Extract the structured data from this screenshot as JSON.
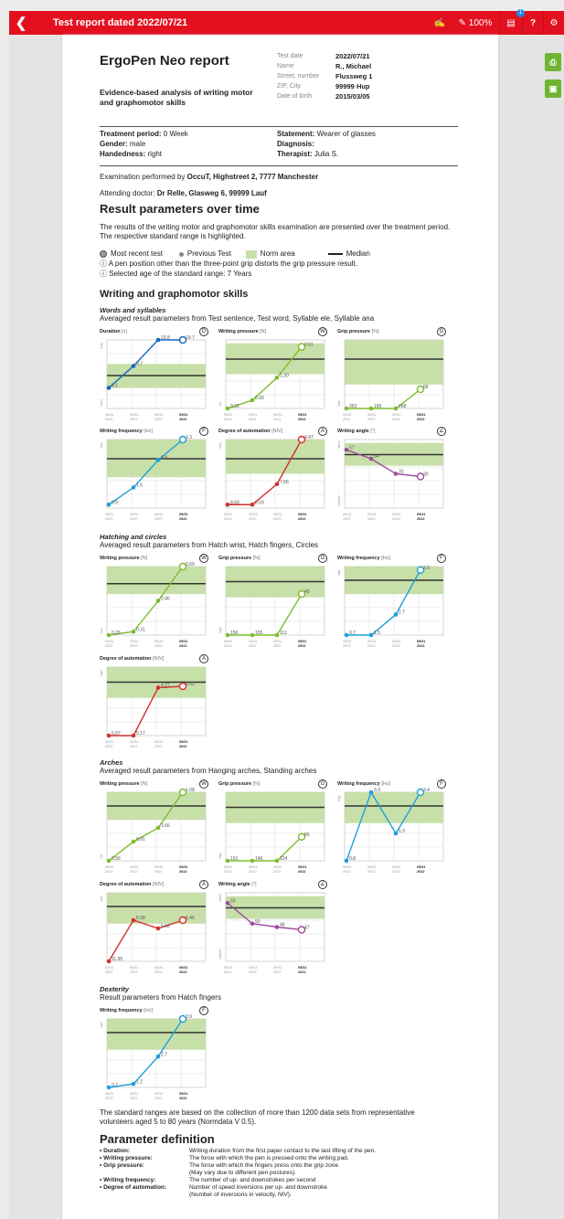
{
  "topbar": {
    "title": "Test report dated 2022/07/21",
    "zoom": "100%",
    "badge": "1",
    "help": "?"
  },
  "report": {
    "title": "ErgoPen Neo report",
    "subtitle": "Evidence-based analysis of writing motor and graphomotor skills",
    "meta": [
      {
        "k": "Test date",
        "v": "2022/07/21"
      },
      {
        "k": "Name",
        "v": "R., Michael"
      },
      {
        "k": "Street, number",
        "v": "Flussweg 1"
      },
      {
        "k": "ZIP, City",
        "v": "99999 Hup"
      },
      {
        "k": "Date of birth",
        "v": "2015/03/05"
      }
    ],
    "info_left": [
      {
        "k": "Treatment period:",
        "v": " 0 Week"
      },
      {
        "k": "Gender:",
        "v": " male"
      },
      {
        "k": "Handedness:",
        "v": " right"
      }
    ],
    "info_right": [
      {
        "k": "Statement:",
        "v": " Wearer of glasses"
      },
      {
        "k": "Diagnosis:",
        "v": ""
      },
      {
        "k": "Therapist:",
        "v": " Julia S."
      }
    ],
    "examination_prefix": "Examination performed by ",
    "examination_value": "OccuT, Highstreet 2, 7777 Manchester",
    "doctor_prefix": "Attending doctor: ",
    "doctor_value": "Dr Relle, Glasweg 6, 99999 Lauf",
    "result_heading": "Result parameters over time",
    "result_text": "The results of the writing motor and graphomotor skills examination are presented over the treatment period. The respective standard range is highlighted.",
    "legend": {
      "most_recent": "Most recent test",
      "previous": "Previous Test",
      "norm": "Norm area",
      "median": "Median"
    },
    "note1": "A pen position other than the three-point grip distorts the grip pressure result.",
    "note2": "Selected age of the standard range: 7 Years",
    "skills_heading": "Writing and graphomotor skills",
    "sections": [
      {
        "title": "Words and syllables",
        "desc": "Averaged result parameters from Test sentence, Test word, Syllable ele, Syllable ana"
      },
      {
        "title": "Hatching and circles",
        "desc": "Averaged result parameters from Hatch wrist, Hatch fingers, Circles"
      },
      {
        "title": "Arches",
        "desc": "Averaged result parameters from Hanging arches, Standing arches"
      },
      {
        "title": "Dexterity",
        "desc": "Result parameters from Hatch fingers"
      }
    ],
    "footer_text": "The standard ranges are based on the collection of more than 1200 data sets from representative volunteers aged 5 to 80 years (Normdata V 0.5).",
    "param_heading": "Parameter definition",
    "params": [
      {
        "k": "• Duration:",
        "v": "Writing duration from the first paper contact to the last lifting of the pen."
      },
      {
        "k": "• Writing pressure:",
        "v": "The force with which the pen is pressed onto the writing pad."
      },
      {
        "k": "• Grip pressure:",
        "v": "The force with which the fingers press onto the grip zone"
      },
      {
        "k": "",
        "v": "(May vary due to different pen postures)."
      },
      {
        "k": "• Writing frequency:",
        "v": "The number of up- and downstrokes per second"
      },
      {
        "k": "• Degree of automation:",
        "v": "Number of speed inversions per up- and downstroke"
      },
      {
        "k": "",
        "v": "(Number of inversions in velocity, NIV)."
      }
    ]
  },
  "chart_labels": {
    "x": [
      "05/31 2022",
      "05/31 2022",
      "05/31 2022",
      "05/31 2022"
    ],
    "high": "high",
    "low": "low",
    "steep": "steep",
    "shallow": "shallow"
  },
  "chart_data": [
    {
      "type": "line",
      "group": "Words and syllables",
      "title": "Duration",
      "unit": "[s]",
      "icon": "D",
      "labels": [
        "8.1",
        "9.7",
        "19.8",
        "19.7"
      ],
      "values": [
        0.3,
        0.62,
        1.0,
        1.0
      ],
      "norm": [
        0.3,
        0.65
      ],
      "median": 0.48,
      "color": "#1565c0",
      "ymax": "long",
      "ymin": "short"
    },
    {
      "type": "line",
      "group": "Words and syllables",
      "title": "Writing pressure",
      "unit": "[N]",
      "icon": "W",
      "labels": [
        "0.31",
        "0.09",
        "1.30",
        "0.91"
      ],
      "values": [
        0.0,
        0.12,
        0.45,
        0.9
      ],
      "norm": [
        0.5,
        0.95
      ],
      "median": 0.72,
      "color": "#7cbd2f",
      "ymin": "low"
    },
    {
      "type": "line",
      "group": "Words and syllables",
      "title": "Grip pressure",
      "unit": "[%]",
      "icon": "G",
      "labels": [
        "363",
        "165",
        "168",
        "68"
      ],
      "values": [
        0.0,
        0.0,
        0.0,
        0.28
      ],
      "norm": [
        0.35,
        1.0
      ],
      "median": 0.72,
      "color": "#7cbd2f",
      "ymin": "high"
    },
    {
      "type": "line",
      "group": "Words and syllables",
      "title": "Writing frequency",
      "unit": "[Hz]",
      "icon": "F",
      "labels": [
        "0.9",
        "1.5",
        "2.8",
        "3.3"
      ],
      "values": [
        0.05,
        0.3,
        0.7,
        1.0
      ],
      "norm": [
        0.45,
        1.0
      ],
      "median": 0.72,
      "color": "#1e9fd8",
      "ymax": "high"
    },
    {
      "type": "line",
      "group": "Words and syllables",
      "title": "Degree of automation",
      "unit": "[NIV]",
      "icon": "A",
      "labels": [
        "8.69",
        "8.69",
        "7.66",
        "4.47"
      ],
      "values": [
        0.05,
        0.05,
        0.35,
        1.0
      ],
      "norm": [
        0.5,
        1.0
      ],
      "median": 0.72,
      "color": "#d32f2f",
      "ymax": "high"
    },
    {
      "type": "line",
      "group": "Words and syllables",
      "title": "Writing angle",
      "unit": "[°]",
      "icon": "∠",
      "labels": [
        "57",
        "64",
        "33",
        "30"
      ],
      "values": [
        0.85,
        0.72,
        0.5,
        0.46
      ],
      "norm": [
        0.62,
        0.95
      ],
      "median": 0.78,
      "color": "#9c4c9c",
      "ymax": "steep",
      "ymin": "shallow"
    },
    {
      "type": "line",
      "group": "Hatching and circles",
      "title": "Writing pressure",
      "unit": "[N]",
      "icon": "W",
      "labels": [
        "0.25",
        "0.31",
        "0.46",
        "0.69"
      ],
      "values": [
        0.0,
        0.05,
        0.5,
        1.0
      ],
      "norm": [
        0.6,
        1.0
      ],
      "median": 0.75,
      "color": "#7cbd2f",
      "ymin": "low"
    },
    {
      "type": "line",
      "group": "Hatching and circles",
      "title": "Grip pressure",
      "unit": "[%]",
      "icon": "G",
      "labels": [
        "150",
        "155",
        "111",
        "49"
      ],
      "values": [
        0.0,
        0.0,
        0.0,
        0.6
      ],
      "norm": [
        0.55,
        1.0
      ],
      "median": 0.78,
      "color": "#7cbd2f",
      "ymin": "high"
    },
    {
      "type": "line",
      "group": "Hatching and circles",
      "title": "Writing frequency",
      "unit": "[Hz]",
      "icon": "F",
      "labels": [
        "0.7",
        "1.5",
        "2.7",
        "3.9"
      ],
      "values": [
        0.0,
        0.0,
        0.3,
        0.95
      ],
      "norm": [
        0.6,
        1.0
      ],
      "median": 0.8,
      "color": "#1e9fd8",
      "ymax": "high"
    },
    {
      "type": "line",
      "group": "Hatching and circles",
      "title": "Degree of automation",
      "unit": "[NIV]",
      "icon": "A",
      "labels": [
        "6.87",
        "5.17",
        "4.27",
        "4.02"
      ],
      "values": [
        0.0,
        0.0,
        0.7,
        0.72
      ],
      "norm": [
        0.55,
        1.0
      ],
      "median": 0.78,
      "color": "#d32f2f",
      "ymax": "high"
    },
    {
      "type": "line",
      "group": "Arches",
      "title": "Writing pressure",
      "unit": "[N]",
      "icon": "W",
      "labels": [
        "0.56",
        "0.91",
        "1.66",
        "1.08"
      ],
      "values": [
        0.0,
        0.28,
        0.48,
        1.0
      ],
      "norm": [
        0.6,
        1.0
      ],
      "median": 0.8,
      "color": "#7cbd2f",
      "ymin": "low"
    },
    {
      "type": "line",
      "group": "Arches",
      "title": "Grip pressure",
      "unit": "[%]",
      "icon": "G",
      "labels": [
        "191",
        "146",
        "124",
        "80"
      ],
      "values": [
        0.0,
        0.0,
        0.0,
        0.35
      ],
      "norm": [
        0.55,
        1.0
      ],
      "median": 0.78,
      "color": "#7cbd2f",
      "ymin": "high"
    },
    {
      "type": "line",
      "group": "Arches",
      "title": "Writing frequency",
      "unit": "[Hz]",
      "icon": "F",
      "labels": [
        "0.8",
        "3.3",
        "1.3",
        "3.4"
      ],
      "values": [
        0.0,
        1.0,
        0.4,
        1.0
      ],
      "norm": [
        0.55,
        1.0
      ],
      "median": 0.8,
      "color": "#1e9fd8",
      "ymax": "high"
    },
    {
      "type": "line",
      "group": "Arches",
      "title": "Degree of automation",
      "unit": "[NIV]",
      "icon": "A",
      "labels": [
        "11.95",
        "6.38",
        "6.58",
        "6.46"
      ],
      "values": [
        0.0,
        0.6,
        0.48,
        0.6
      ],
      "norm": [
        0.55,
        1.0
      ],
      "median": 0.8,
      "color": "#d32f2f",
      "ymax": "high"
    },
    {
      "type": "line",
      "group": "Arches",
      "title": "Writing angle",
      "unit": "[°]",
      "icon": "∠",
      "labels": [
        "59",
        "50",
        "48",
        "47"
      ],
      "values": [
        0.85,
        0.55,
        0.5,
        0.46
      ],
      "norm": [
        0.62,
        0.95
      ],
      "median": 0.78,
      "color": "#9c4c9c",
      "ymax": "steep",
      "ymin": "shallow"
    },
    {
      "type": "line",
      "group": "Dexterity",
      "title": "Writing frequency",
      "unit": "[Hz]",
      "icon": "F",
      "labels": [
        "0.7",
        "1.2",
        "2.7",
        "3.9"
      ],
      "values": [
        0.0,
        0.05,
        0.45,
        1.0
      ],
      "norm": [
        0.55,
        1.0
      ],
      "median": 0.8,
      "color": "#1e9fd8",
      "ymax": "high"
    }
  ]
}
